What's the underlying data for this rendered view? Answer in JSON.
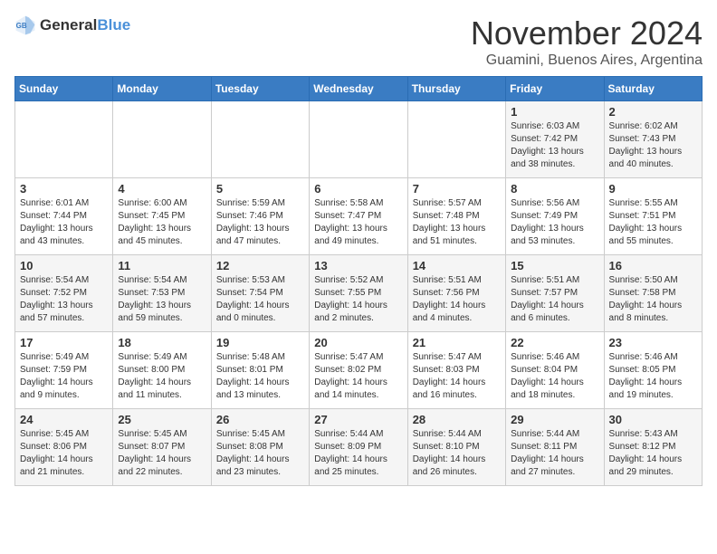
{
  "logo": {
    "text_general": "General",
    "text_blue": "Blue"
  },
  "title": "November 2024",
  "subtitle": "Guamini, Buenos Aires, Argentina",
  "days_of_week": [
    "Sunday",
    "Monday",
    "Tuesday",
    "Wednesday",
    "Thursday",
    "Friday",
    "Saturday"
  ],
  "weeks": [
    [
      {
        "day": "",
        "info": ""
      },
      {
        "day": "",
        "info": ""
      },
      {
        "day": "",
        "info": ""
      },
      {
        "day": "",
        "info": ""
      },
      {
        "day": "",
        "info": ""
      },
      {
        "day": "1",
        "info": "Sunrise: 6:03 AM\nSunset: 7:42 PM\nDaylight: 13 hours\nand 38 minutes."
      },
      {
        "day": "2",
        "info": "Sunrise: 6:02 AM\nSunset: 7:43 PM\nDaylight: 13 hours\nand 40 minutes."
      }
    ],
    [
      {
        "day": "3",
        "info": "Sunrise: 6:01 AM\nSunset: 7:44 PM\nDaylight: 13 hours\nand 43 minutes."
      },
      {
        "day": "4",
        "info": "Sunrise: 6:00 AM\nSunset: 7:45 PM\nDaylight: 13 hours\nand 45 minutes."
      },
      {
        "day": "5",
        "info": "Sunrise: 5:59 AM\nSunset: 7:46 PM\nDaylight: 13 hours\nand 47 minutes."
      },
      {
        "day": "6",
        "info": "Sunrise: 5:58 AM\nSunset: 7:47 PM\nDaylight: 13 hours\nand 49 minutes."
      },
      {
        "day": "7",
        "info": "Sunrise: 5:57 AM\nSunset: 7:48 PM\nDaylight: 13 hours\nand 51 minutes."
      },
      {
        "day": "8",
        "info": "Sunrise: 5:56 AM\nSunset: 7:49 PM\nDaylight: 13 hours\nand 53 minutes."
      },
      {
        "day": "9",
        "info": "Sunrise: 5:55 AM\nSunset: 7:51 PM\nDaylight: 13 hours\nand 55 minutes."
      }
    ],
    [
      {
        "day": "10",
        "info": "Sunrise: 5:54 AM\nSunset: 7:52 PM\nDaylight: 13 hours\nand 57 minutes."
      },
      {
        "day": "11",
        "info": "Sunrise: 5:54 AM\nSunset: 7:53 PM\nDaylight: 13 hours\nand 59 minutes."
      },
      {
        "day": "12",
        "info": "Sunrise: 5:53 AM\nSunset: 7:54 PM\nDaylight: 14 hours\nand 0 minutes."
      },
      {
        "day": "13",
        "info": "Sunrise: 5:52 AM\nSunset: 7:55 PM\nDaylight: 14 hours\nand 2 minutes."
      },
      {
        "day": "14",
        "info": "Sunrise: 5:51 AM\nSunset: 7:56 PM\nDaylight: 14 hours\nand 4 minutes."
      },
      {
        "day": "15",
        "info": "Sunrise: 5:51 AM\nSunset: 7:57 PM\nDaylight: 14 hours\nand 6 minutes."
      },
      {
        "day": "16",
        "info": "Sunrise: 5:50 AM\nSunset: 7:58 PM\nDaylight: 14 hours\nand 8 minutes."
      }
    ],
    [
      {
        "day": "17",
        "info": "Sunrise: 5:49 AM\nSunset: 7:59 PM\nDaylight: 14 hours\nand 9 minutes."
      },
      {
        "day": "18",
        "info": "Sunrise: 5:49 AM\nSunset: 8:00 PM\nDaylight: 14 hours\nand 11 minutes."
      },
      {
        "day": "19",
        "info": "Sunrise: 5:48 AM\nSunset: 8:01 PM\nDaylight: 14 hours\nand 13 minutes."
      },
      {
        "day": "20",
        "info": "Sunrise: 5:47 AM\nSunset: 8:02 PM\nDaylight: 14 hours\nand 14 minutes."
      },
      {
        "day": "21",
        "info": "Sunrise: 5:47 AM\nSunset: 8:03 PM\nDaylight: 14 hours\nand 16 minutes."
      },
      {
        "day": "22",
        "info": "Sunrise: 5:46 AM\nSunset: 8:04 PM\nDaylight: 14 hours\nand 18 minutes."
      },
      {
        "day": "23",
        "info": "Sunrise: 5:46 AM\nSunset: 8:05 PM\nDaylight: 14 hours\nand 19 minutes."
      }
    ],
    [
      {
        "day": "24",
        "info": "Sunrise: 5:45 AM\nSunset: 8:06 PM\nDaylight: 14 hours\nand 21 minutes."
      },
      {
        "day": "25",
        "info": "Sunrise: 5:45 AM\nSunset: 8:07 PM\nDaylight: 14 hours\nand 22 minutes."
      },
      {
        "day": "26",
        "info": "Sunrise: 5:45 AM\nSunset: 8:08 PM\nDaylight: 14 hours\nand 23 minutes."
      },
      {
        "day": "27",
        "info": "Sunrise: 5:44 AM\nSunset: 8:09 PM\nDaylight: 14 hours\nand 25 minutes."
      },
      {
        "day": "28",
        "info": "Sunrise: 5:44 AM\nSunset: 8:10 PM\nDaylight: 14 hours\nand 26 minutes."
      },
      {
        "day": "29",
        "info": "Sunrise: 5:44 AM\nSunset: 8:11 PM\nDaylight: 14 hours\nand 27 minutes."
      },
      {
        "day": "30",
        "info": "Sunrise: 5:43 AM\nSunset: 8:12 PM\nDaylight: 14 hours\nand 29 minutes."
      }
    ]
  ]
}
